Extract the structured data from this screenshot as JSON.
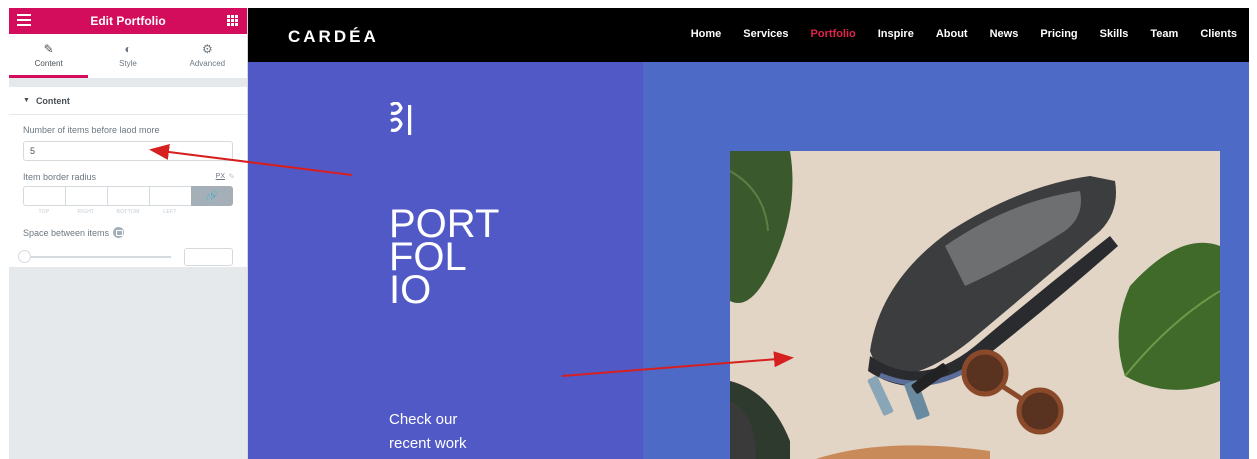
{
  "editor": {
    "panel_title": "Edit Portfolio",
    "tabs": [
      {
        "label": "Content",
        "icon": "pencil-icon"
      },
      {
        "label": "Style",
        "icon": "contrast-icon"
      },
      {
        "label": "Advanced",
        "icon": "gear-icon"
      }
    ],
    "active_tab": "Content",
    "section_title": "Content",
    "controls": {
      "items_label": "Number of items before laod more",
      "items_value": "5",
      "radius_label": "Item border radius",
      "radius_unit": "PX",
      "dim_labels": [
        "TOP",
        "RIGHT",
        "BOTTOM",
        "LEFT"
      ],
      "space_label": "Space between items"
    },
    "accent_color": "#d30c5c"
  },
  "site": {
    "logo": "CARDÉA",
    "nav": [
      "Home",
      "Services",
      "Portfolio",
      "Inspire",
      "About",
      "News",
      "Pricing",
      "Skills",
      "Team",
      "Clients"
    ],
    "active_nav": "Portfolio",
    "hero": {
      "title_lines": [
        "PORT",
        "FOL",
        "IO"
      ],
      "subtitle_lines": [
        "Check our",
        "recent work"
      ]
    },
    "colors": {
      "hero_left": "#5159c7",
      "hero_right": "#4e6ac7",
      "nav_active": "#e2224c"
    }
  }
}
